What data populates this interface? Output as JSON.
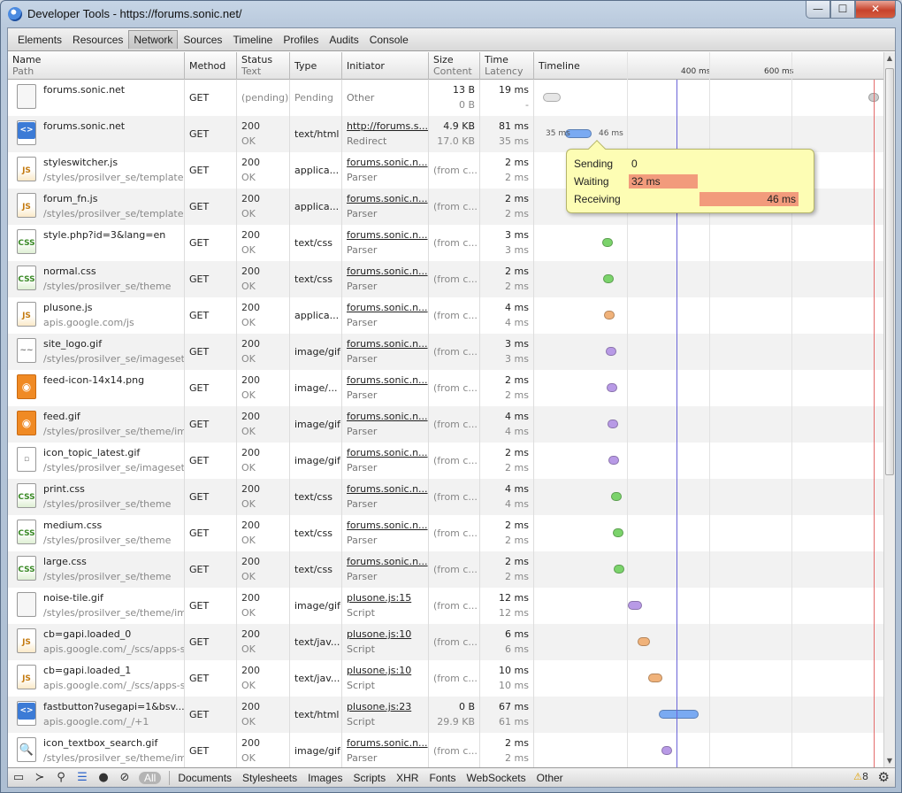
{
  "window": {
    "title": "Developer Tools - https://forums.sonic.net/",
    "min": "—",
    "max": "☐",
    "close": "✕"
  },
  "tabs": [
    "Elements",
    "Resources",
    "Network",
    "Sources",
    "Timeline",
    "Profiles",
    "Audits",
    "Console"
  ],
  "active_tab": "Network",
  "columns": {
    "name": {
      "label": "Name",
      "sub": "Path"
    },
    "method": {
      "label": "Method"
    },
    "status": {
      "label": "Status",
      "sub": "Text"
    },
    "type": {
      "label": "Type"
    },
    "initiator": {
      "label": "Initiator"
    },
    "size": {
      "label": "Size",
      "sub": "Content"
    },
    "time": {
      "label": "Time",
      "sub": "Latency"
    },
    "timeline": {
      "label": "Timeline"
    }
  },
  "timeline_ticks": [
    "400 ms",
    "600 ms"
  ],
  "rows": [
    {
      "name": "forums.sonic.net",
      "path": "",
      "method": "GET",
      "status": "(pending)",
      "status_text": "",
      "type": "Pending",
      "initiator": "",
      "initiator_text": "Other",
      "size": "13 B",
      "content": "0 B",
      "time": "19 ms",
      "latency": "-",
      "icon": "blank",
      "icon_label": ""
    },
    {
      "name": "forums.sonic.net",
      "path": "",
      "method": "GET",
      "status": "200",
      "status_text": "OK",
      "type": "text/html",
      "initiator": "http://forums.s...",
      "initiator_text": "Redirect",
      "size": "4.9 KB",
      "content": "17.0 KB",
      "time": "81 ms",
      "latency": "35 ms",
      "icon": "html",
      "icon_label": "<>"
    },
    {
      "name": "styleswitcher.js",
      "path": "/styles/prosilver_se/template",
      "method": "GET",
      "status": "200",
      "status_text": "OK",
      "type": "applica...",
      "initiator": "forums.sonic.n...",
      "initiator_text": "Parser",
      "size": "(from c...",
      "content": "",
      "time": "2 ms",
      "latency": "2 ms",
      "icon": "js",
      "icon_label": "JS"
    },
    {
      "name": "forum_fn.js",
      "path": "/styles/prosilver_se/template",
      "method": "GET",
      "status": "200",
      "status_text": "OK",
      "type": "applica...",
      "initiator": "forums.sonic.n...",
      "initiator_text": "Parser",
      "size": "(from c...",
      "content": "",
      "time": "2 ms",
      "latency": "2 ms",
      "icon": "js",
      "icon_label": "JS"
    },
    {
      "name": "style.php?id=3&lang=en",
      "path": "",
      "method": "GET",
      "status": "200",
      "status_text": "OK",
      "type": "text/css",
      "initiator": "forums.sonic.n...",
      "initiator_text": "Parser",
      "size": "(from c...",
      "content": "",
      "time": "3 ms",
      "latency": "3 ms",
      "icon": "css",
      "icon_label": "CSS"
    },
    {
      "name": "normal.css",
      "path": "/styles/prosilver_se/theme",
      "method": "GET",
      "status": "200",
      "status_text": "OK",
      "type": "text/css",
      "initiator": "forums.sonic.n...",
      "initiator_text": "Parser",
      "size": "(from c...",
      "content": "",
      "time": "2 ms",
      "latency": "2 ms",
      "icon": "css",
      "icon_label": "CSS"
    },
    {
      "name": "plusone.js",
      "path": "apis.google.com/js",
      "method": "GET",
      "status": "200",
      "status_text": "OK",
      "type": "applica...",
      "initiator": "forums.sonic.n...",
      "initiator_text": "Parser",
      "size": "(from c...",
      "content": "",
      "time": "4 ms",
      "latency": "4 ms",
      "icon": "js",
      "icon_label": "JS"
    },
    {
      "name": "site_logo.gif",
      "path": "/styles/prosilver_se/imageset",
      "method": "GET",
      "status": "200",
      "status_text": "OK",
      "type": "image/gif",
      "initiator": "forums.sonic.n...",
      "initiator_text": "Parser",
      "size": "(from c...",
      "content": "",
      "time": "3 ms",
      "latency": "3 ms",
      "icon": "img",
      "icon_label": "~~"
    },
    {
      "name": "feed-icon-14x14.png",
      "path": "",
      "method": "GET",
      "status": "200",
      "status_text": "OK",
      "type": "image/...",
      "initiator": "forums.sonic.n...",
      "initiator_text": "Parser",
      "size": "(from c...",
      "content": "",
      "time": "2 ms",
      "latency": "2 ms",
      "icon": "feed",
      "icon_label": "◉"
    },
    {
      "name": "feed.gif",
      "path": "/styles/prosilver_se/theme/ima",
      "method": "GET",
      "status": "200",
      "status_text": "OK",
      "type": "image/gif",
      "initiator": "forums.sonic.n...",
      "initiator_text": "Parser",
      "size": "(from c...",
      "content": "",
      "time": "4 ms",
      "latency": "4 ms",
      "icon": "feed",
      "icon_label": "◉"
    },
    {
      "name": "icon_topic_latest.gif",
      "path": "/styles/prosilver_se/imageset",
      "method": "GET",
      "status": "200",
      "status_text": "OK",
      "type": "image/gif",
      "initiator": "forums.sonic.n...",
      "initiator_text": "Parser",
      "size": "(from c...",
      "content": "",
      "time": "2 ms",
      "latency": "2 ms",
      "icon": "img",
      "icon_label": "▫"
    },
    {
      "name": "print.css",
      "path": "/styles/prosilver_se/theme",
      "method": "GET",
      "status": "200",
      "status_text": "OK",
      "type": "text/css",
      "initiator": "forums.sonic.n...",
      "initiator_text": "Parser",
      "size": "(from c...",
      "content": "",
      "time": "4 ms",
      "latency": "4 ms",
      "icon": "css",
      "icon_label": "CSS"
    },
    {
      "name": "medium.css",
      "path": "/styles/prosilver_se/theme",
      "method": "GET",
      "status": "200",
      "status_text": "OK",
      "type": "text/css",
      "initiator": "forums.sonic.n...",
      "initiator_text": "Parser",
      "size": "(from c...",
      "content": "",
      "time": "2 ms",
      "latency": "2 ms",
      "icon": "css",
      "icon_label": "CSS"
    },
    {
      "name": "large.css",
      "path": "/styles/prosilver_se/theme",
      "method": "GET",
      "status": "200",
      "status_text": "OK",
      "type": "text/css",
      "initiator": "forums.sonic.n...",
      "initiator_text": "Parser",
      "size": "(from c...",
      "content": "",
      "time": "2 ms",
      "latency": "2 ms",
      "icon": "css",
      "icon_label": "CSS"
    },
    {
      "name": "noise-tile.gif",
      "path": "/styles/prosilver_se/theme/ima",
      "method": "GET",
      "status": "200",
      "status_text": "OK",
      "type": "image/gif",
      "initiator": "plusone.js:15",
      "initiator_text": "Script",
      "size": "(from c...",
      "content": "",
      "time": "12 ms",
      "latency": "12 ms",
      "icon": "blank",
      "icon_label": ""
    },
    {
      "name": "cb=gapi.loaded_0",
      "path": "apis.google.com/_/scs/apps-st",
      "method": "GET",
      "status": "200",
      "status_text": "OK",
      "type": "text/jav...",
      "initiator": "plusone.js:10",
      "initiator_text": "Script",
      "size": "(from c...",
      "content": "",
      "time": "6 ms",
      "latency": "6 ms",
      "icon": "js",
      "icon_label": "JS"
    },
    {
      "name": "cb=gapi.loaded_1",
      "path": "apis.google.com/_/scs/apps-st",
      "method": "GET",
      "status": "200",
      "status_text": "OK",
      "type": "text/jav...",
      "initiator": "plusone.js:10",
      "initiator_text": "Script",
      "size": "(from c...",
      "content": "",
      "time": "10 ms",
      "latency": "10 ms",
      "icon": "js",
      "icon_label": "JS"
    },
    {
      "name": "fastbutton?usegapi=1&bsv...",
      "path": "apis.google.com/_/+1",
      "method": "GET",
      "status": "200",
      "status_text": "OK",
      "type": "text/html",
      "initiator": "plusone.js:23",
      "initiator_text": "Script",
      "size": "0 B",
      "content": "29.9 KB",
      "time": "67 ms",
      "latency": "61 ms",
      "icon": "html",
      "icon_label": "<>"
    },
    {
      "name": "icon_textbox_search.gif",
      "path": "/styles/prosilver_se/theme/ima",
      "method": "GET",
      "status": "200",
      "status_text": "OK",
      "type": "image/gif",
      "initiator": "forums.sonic.n...",
      "initiator_text": "Parser",
      "size": "(from c...",
      "content": "",
      "time": "2 ms",
      "latency": "2 ms",
      "icon": "search",
      "icon_label": "🔍"
    }
  ],
  "timeline_inline": {
    "left": "35 ms",
    "right": "46 ms"
  },
  "tooltip": {
    "sending_label": "Sending",
    "sending_value": "0",
    "waiting_label": "Waiting",
    "waiting_value": "32 ms",
    "receiving_label": "Receiving",
    "receiving_value": "46 ms"
  },
  "filters": [
    "All",
    "Documents",
    "Stylesheets",
    "Images",
    "Scripts",
    "XHR",
    "Fonts",
    "WebSockets",
    "Other"
  ],
  "active_filter": "All",
  "warnings_count": "8",
  "colors": {
    "dom_line": "#6a64d8",
    "load_line": "#e46b6b",
    "css": "#7bd36b",
    "js": "#f0b27a",
    "img": "#b89ae6",
    "doc": "#7aaaf2"
  }
}
